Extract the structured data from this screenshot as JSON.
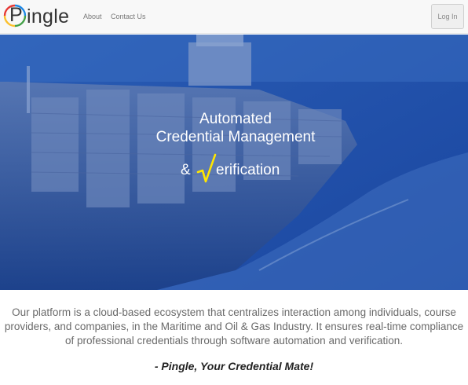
{
  "brand": {
    "logo_letter": "P",
    "logo_rest": "ingle"
  },
  "nav": {
    "about": "About",
    "contact": "Contact Us",
    "login": "Log In"
  },
  "hero": {
    "line1": "Automated",
    "line2": "Credential Management",
    "ampersand": "&",
    "verification_rest": "erification"
  },
  "content": {
    "description": "Our platform is a cloud-based ecosystem that centralizes interaction among individuals, course providers, and companies, in the Maritime and Oil & Gas Industry. It ensures real-time compliance of professional credentials through software automation and verification.",
    "tagline": "- Pingle, Your Credential Mate!"
  },
  "colors": {
    "hero_blue": "#1a4ca6",
    "check_yellow": "#ffe600",
    "logo_ring": [
      "#e53935",
      "#fbc02d",
      "#43a047",
      "#1e88e5"
    ]
  }
}
